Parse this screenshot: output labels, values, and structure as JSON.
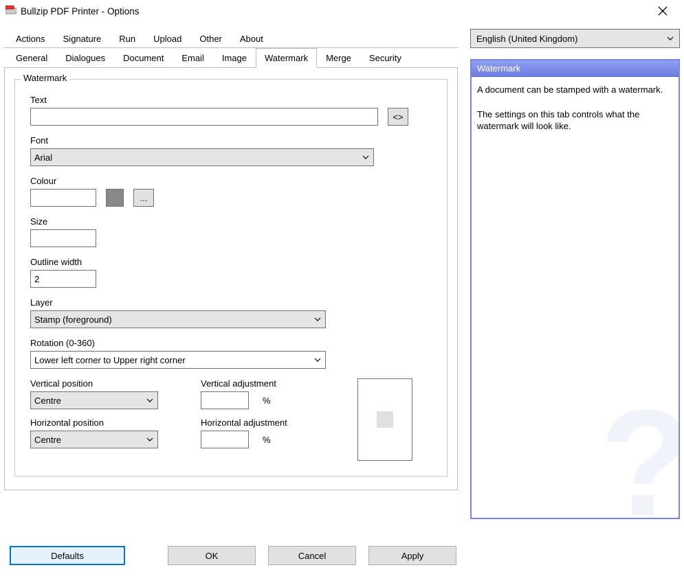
{
  "window": {
    "title": "Bullzip PDF Printer - Options"
  },
  "tabs_row1": [
    "Actions",
    "Signature",
    "Run",
    "Upload",
    "Other",
    "About"
  ],
  "tabs_row2": [
    "General",
    "Dialogues",
    "Document",
    "Email",
    "Image",
    "Watermark",
    "Merge",
    "Security"
  ],
  "active_tab": "Watermark",
  "watermark": {
    "legend": "Watermark",
    "text_label": "Text",
    "text_value": "",
    "macro_btn": "<>",
    "font_label": "Font",
    "font_value": "Arial",
    "colour_label": "Colour",
    "colour_value": "",
    "colour_browse": "...",
    "size_label": "Size",
    "size_value": "",
    "outline_label": "Outline width",
    "outline_value": "2",
    "layer_label": "Layer",
    "layer_value": "Stamp (foreground)",
    "rotation_label": "Rotation (0-360)",
    "rotation_value": "Lower left corner to Upper right corner",
    "vpos_label": "Vertical position",
    "vpos_value": "Centre",
    "vadj_label": "Vertical adjustment",
    "vadj_value": "",
    "hpos_label": "Horizontal position",
    "hpos_value": "Centre",
    "hadj_label": "Horizontal adjustment",
    "hadj_value": "",
    "percent": "%"
  },
  "language": {
    "value": "English (United Kingdom)"
  },
  "help": {
    "title": "Watermark",
    "p1": "A document can be stamped with a watermark.",
    "p2": "The settings on this tab controls what the watermark will look like."
  },
  "buttons": {
    "defaults": "Defaults",
    "ok": "OK",
    "cancel": "Cancel",
    "apply": "Apply"
  }
}
